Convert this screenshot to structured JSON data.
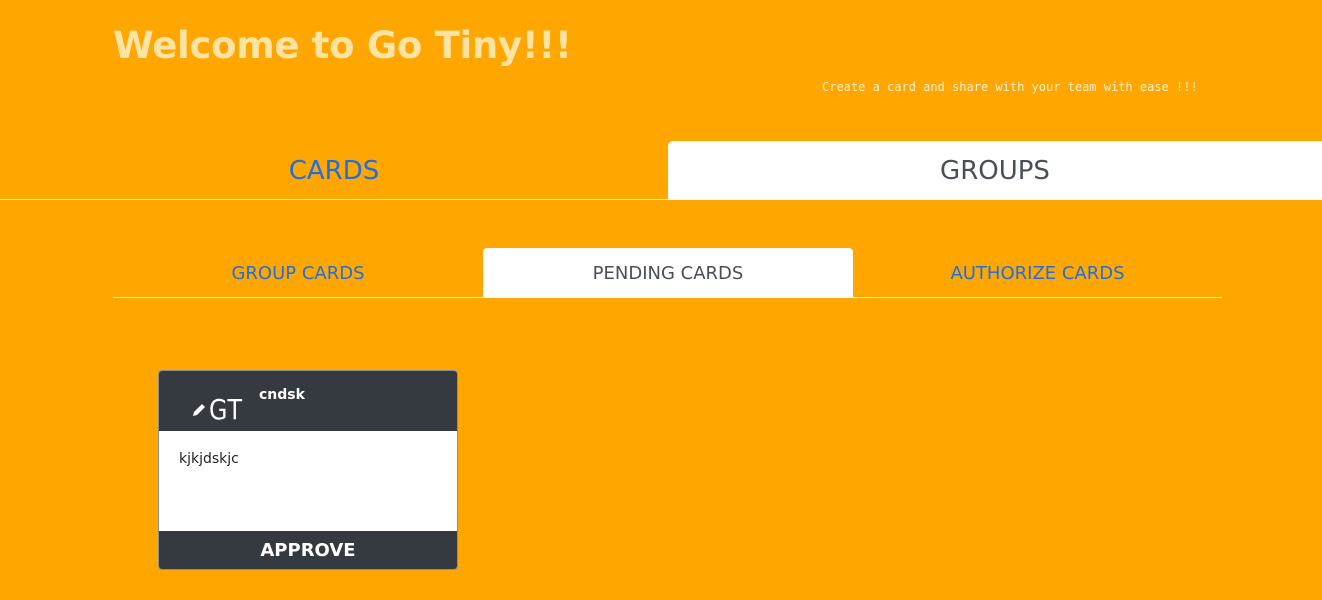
{
  "header": {
    "title": "Welcome to Go Tiny!!!",
    "subtitle": "Create a card and share with your team with ease !!!"
  },
  "main_tabs": [
    {
      "label": "CARDS",
      "active": false
    },
    {
      "label": "GROUPS",
      "active": true
    }
  ],
  "sub_tabs": [
    {
      "label": "GROUP CARDS",
      "active": false
    },
    {
      "label": "PENDING CARDS",
      "active": true
    },
    {
      "label": "AUTHORIZE CARDS",
      "active": false
    }
  ],
  "cards": [
    {
      "logo_icon": "pencil-icon",
      "logo_text": "GT",
      "title": "cndsk",
      "body": "kjkjdskjc",
      "action_label": "APPROVE"
    }
  ],
  "colors": {
    "background": "#ffa600",
    "link": "#1e6fe0",
    "card_dark": "#343a40",
    "title": "#ffe3a3"
  }
}
